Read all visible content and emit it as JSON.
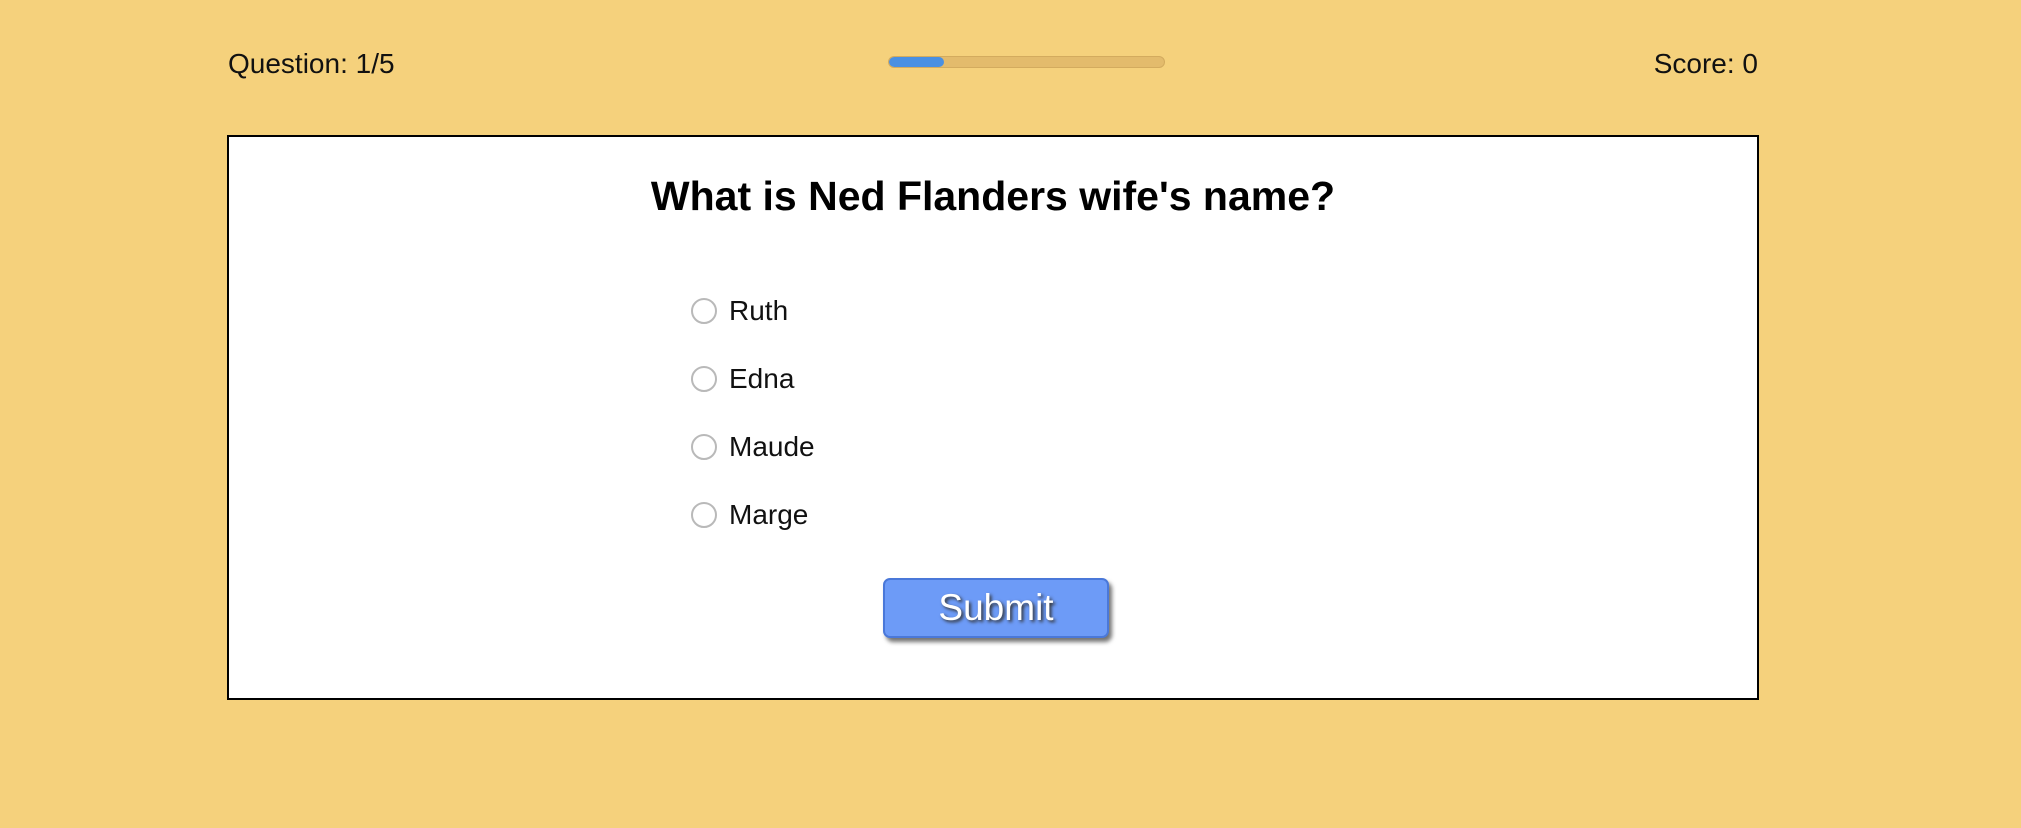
{
  "header": {
    "question_counter": "Question: 1/5",
    "score": "Score: 0",
    "progress": {
      "current": 1,
      "total": 5,
      "fraction": 0.2
    }
  },
  "quiz": {
    "question": "What is Ned Flanders wife's name?",
    "options": [
      {
        "label": "Ruth",
        "selected": false
      },
      {
        "label": "Edna",
        "selected": false
      },
      {
        "label": "Maude",
        "selected": false
      },
      {
        "label": "Marge",
        "selected": false
      }
    ],
    "submit_label": "Submit"
  },
  "colors": {
    "background": "#f5d17c",
    "progress_track": "#e3bb6c",
    "progress_fill": "#4a90e2",
    "card": "#ffffff",
    "submit_button": "#6d9bf7"
  }
}
